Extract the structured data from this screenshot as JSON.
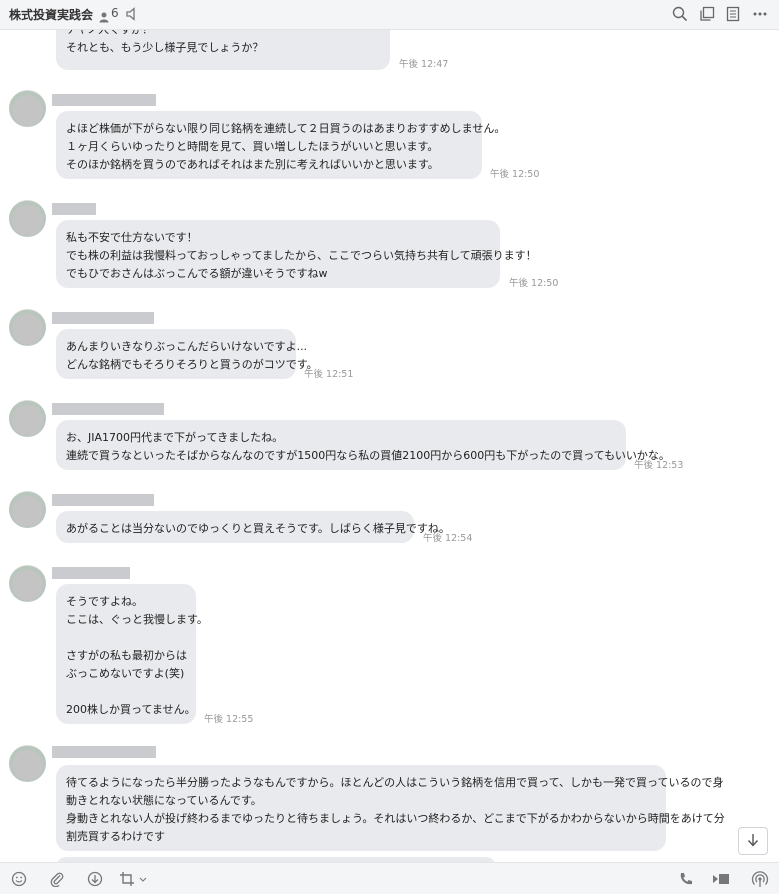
{
  "header": {
    "title": "株式投資実践会",
    "member_count": "6",
    "icons": [
      "member-icon",
      "mute-icon",
      "search-icon",
      "copy-icon",
      "note-icon",
      "more-icon"
    ]
  },
  "messages": [
    {
      "text": "ナヤノ人ぐすか？\nそれとも、もう少し様子見でしょうか？",
      "time": "午後 12:47"
    },
    {
      "text": "よほど株価が下がらない限り同じ銘柄を連続して２日買うのはあまりおすすめしません。\n１ヶ月くらいゆったりと時間を見て、買い増ししたほうがいいと思います。\nそのほか銘柄を買うのであればそれはまた別に考えればいいかと思います。",
      "time": "午後 12:50"
    },
    {
      "text": "私も不安で仕方ないです！\nでも株の利益は我慢料っておっしゃってましたから、ここでつらい気持ち共有して頑張ります！\nでもひでおさんはぶっこんでる額が違いそうですねw",
      "time": "午後 12:50"
    },
    {
      "text": "あんまりいきなりぶっこんだらいけないですよ...\nどんな銘柄でもそろりそろりと買うのがコツです。",
      "time": "午後 12:51"
    },
    {
      "text": "お、JIA1700円代まで下がってきましたね。\n連続で買うなといったそばからなんなのですが1500円なら私の買値2100円から600円も下がったので買ってもいいかな。",
      "time": "午後 12:53"
    },
    {
      "text": "あがることは当分ないのでゆっくりと買えそうです。しばらく様子見ですね。",
      "time": "午後 12:54"
    },
    {
      "text": "そうですよね。\nここは、ぐっと我慢します。\n\nさすがの私も最初からは\nぶっこめないですよ(笑)\n\n200株しか買ってません。",
      "time": "午後 12:55"
    },
    {
      "text": "待てるようになったら半分勝ったようなもんですから。ほとんどの人はこういう銘柄を信用で買って、しかも一発で買っているので身\n動きとれない状態になっているんです。\n身動きとれない人が投げ終わるまでゆったりと待ちましょう。それはいつ終わるか、どこまで下がるかわからないから時間をあけて分\n割売買するわけです",
      "time": ""
    }
  ],
  "toolbar": {
    "icons": [
      "emoji-icon",
      "attach-icon",
      "download-icon",
      "crop-icon",
      "phone-icon",
      "video-icon",
      "broadcast-icon"
    ]
  }
}
